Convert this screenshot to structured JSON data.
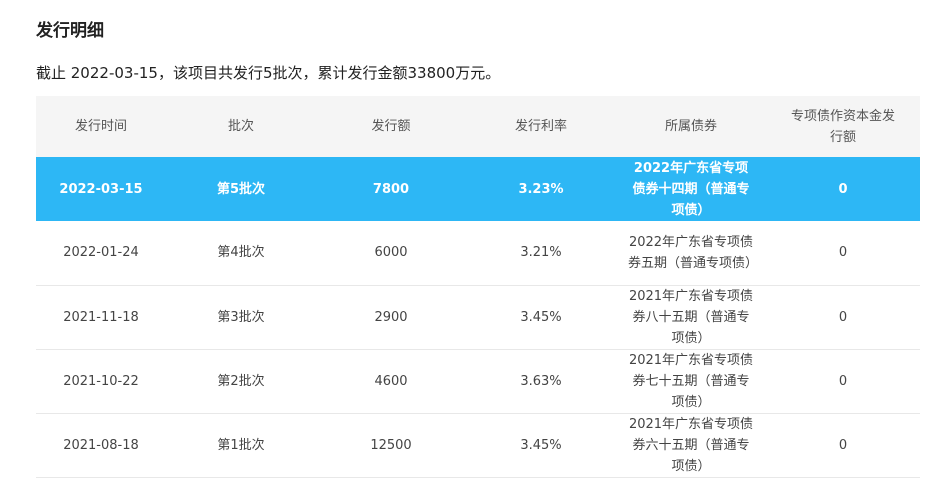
{
  "section": {
    "title": "发行明细",
    "summary": "截止 2022-03-15，该项目共发行5批次，累计发行金额33800万元。"
  },
  "table": {
    "headers": [
      "发行时间",
      "批次",
      "发行额",
      "发行利率",
      "所属债券",
      "专项债作资本金发行额"
    ],
    "rows": [
      {
        "date": "2022-03-15",
        "batch": "第5批次",
        "amount": "7800",
        "rate": "3.23%",
        "bond": "2022年广东省专项债券十四期（普通专项债）",
        "capital": "0",
        "selected": true
      },
      {
        "date": "2022-01-24",
        "batch": "第4批次",
        "amount": "6000",
        "rate": "3.21%",
        "bond": "2022年广东省专项债券五期（普通专项债）",
        "capital": "0",
        "selected": false
      },
      {
        "date": "2021-11-18",
        "batch": "第3批次",
        "amount": "2900",
        "rate": "3.45%",
        "bond": "2021年广东省专项债券八十五期（普通专项债）",
        "capital": "0",
        "selected": false
      },
      {
        "date": "2021-10-22",
        "batch": "第2批次",
        "amount": "4600",
        "rate": "3.63%",
        "bond": "2021年广东省专项债券七十五期（普通专项债）",
        "capital": "0",
        "selected": false
      },
      {
        "date": "2021-08-18",
        "batch": "第1批次",
        "amount": "12500",
        "rate": "3.45%",
        "bond": "2021年广东省专项债券六十五期（普通专项债）",
        "capital": "0",
        "selected": false
      }
    ]
  },
  "colors": {
    "selected_row": "#2db7f5",
    "header_bg": "#f5f5f5"
  }
}
